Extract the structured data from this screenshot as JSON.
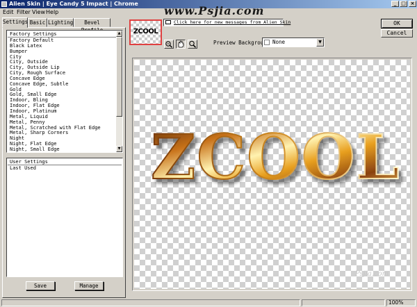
{
  "window": {
    "title": "Alien Skin | Eye Candy 5 Impact | Chrome",
    "minimize": "_",
    "maximize": "□",
    "close": "×"
  },
  "watermark_top": "www.Psjia.com",
  "watermark_bottom": "Psjia.com",
  "menu": [
    {
      "label": "Edit"
    },
    {
      "label": "Filter"
    },
    {
      "label": "View"
    },
    {
      "label": "Help"
    }
  ],
  "tabs": [
    {
      "label": "Settings"
    },
    {
      "label": "Basic"
    },
    {
      "label": "Lighting"
    },
    {
      "label": "Bevel Profile"
    }
  ],
  "factory_settings": {
    "header": "Factory Settings",
    "items": [
      "Factory Default",
      "Black Latex",
      "Bumper",
      "City",
      "City, Outside",
      "City, Outside Lip",
      "City, Rough Surface",
      "Concave Edge",
      "Concave Edge, Subtle",
      "Gold",
      "Gold, Small Edge",
      "Indoor, Bling",
      "Indoor, Flat Edge",
      "Indoor, Platinum",
      "Metal, Liquid",
      "Metal, Penny",
      "Metal, Scratched with Flat Edge",
      "Metal, Sharp Corners",
      "Night",
      "Night, Flat Edge",
      "Night, Small Edge"
    ]
  },
  "user_settings": {
    "header": "User Settings",
    "items": [
      "Last Used"
    ]
  },
  "buttons": {
    "save": "Save",
    "manage": "Manage",
    "ok": "OK",
    "cancel": "Cancel"
  },
  "thumbnail_text": "ZCOOL",
  "message": "Click here for new messages from Alien Skin",
  "toolbar": {
    "preview_background_label": "Preview Background:",
    "preview_background_value": "None"
  },
  "preview_text": "ZCOOL",
  "status": {
    "zoom": "100%"
  },
  "colors": {
    "chrome": "#d4d0c8",
    "titlebar_start": "#0a246a",
    "titlebar_end": "#a6caf0",
    "glass_light": "#fff2b0",
    "glass_mid": "#e8a020",
    "glass_dark": "#5a2a05"
  },
  "icons": {
    "zoom_reset": "zoom-fit-icon",
    "hand": "hand-icon",
    "zoom": "magnifier-icon",
    "message": "envelope-icon"
  }
}
